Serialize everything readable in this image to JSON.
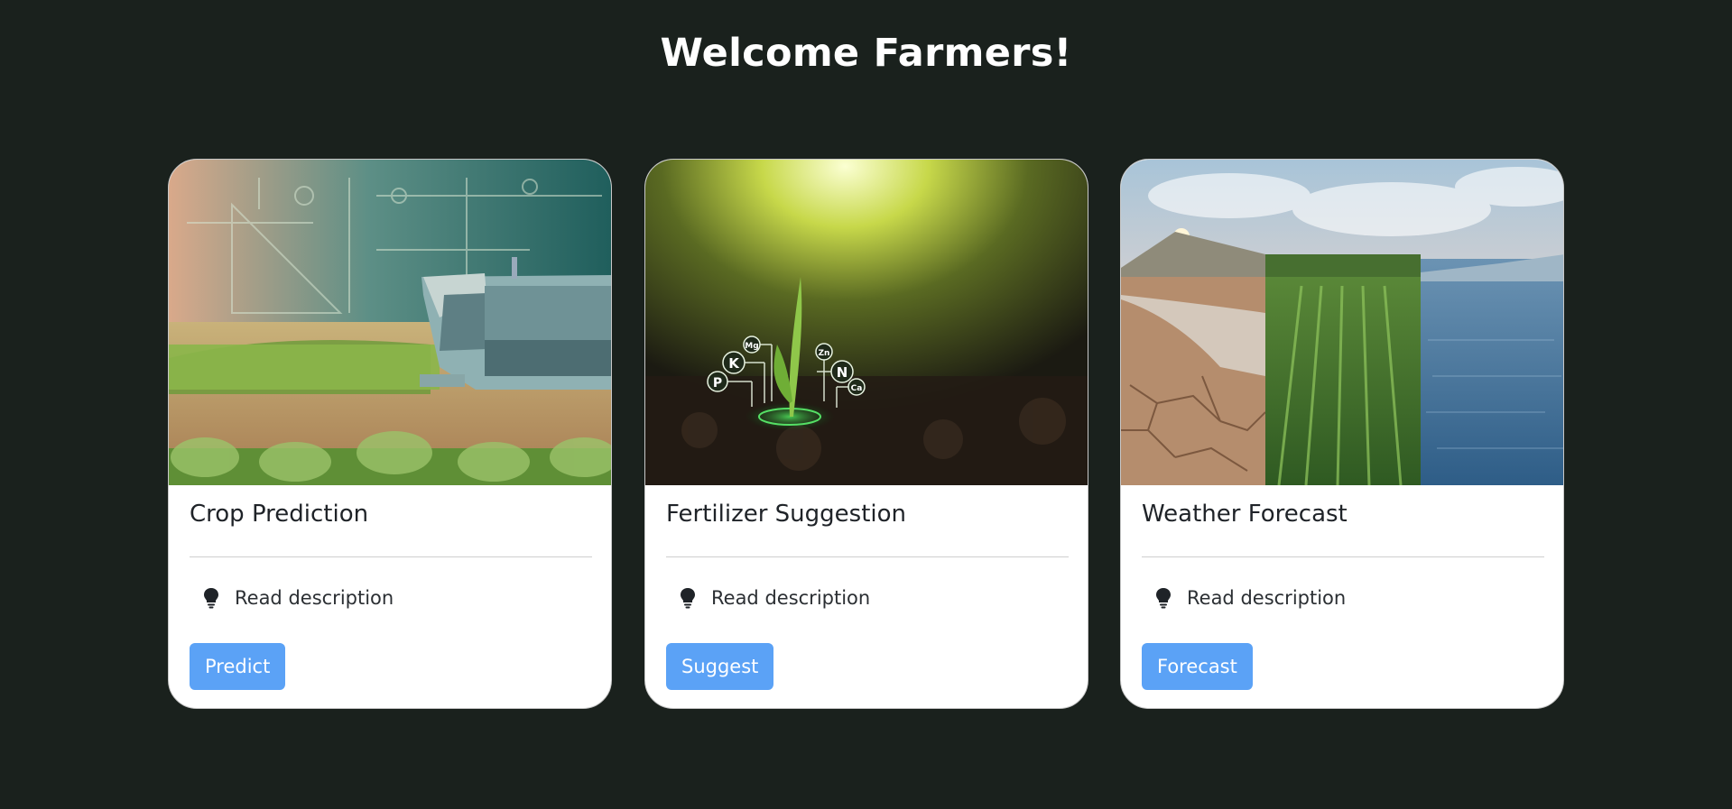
{
  "page": {
    "title": "Welcome Farmers!"
  },
  "cards": [
    {
      "title": "Crop Prediction",
      "description_link": "Read description",
      "button_label": "Predict",
      "image": "autonomous-harvester-in-corn-field"
    },
    {
      "title": "Fertilizer Suggestion",
      "description_link": "Read description",
      "button_label": "Suggest",
      "image": "seedling-with-nutrient-icons",
      "nutrient_labels": [
        "P",
        "K",
        "Mg",
        "Zn",
        "N",
        "Ca"
      ]
    },
    {
      "title": "Weather Forecast",
      "description_link": "Read description",
      "button_label": "Forecast",
      "image": "drought-field-flood-triptych"
    }
  ],
  "icons": {
    "description": "lightbulb-icon"
  },
  "colors": {
    "background": "#1a211d",
    "card": "#ffffff",
    "button": "#5ba2f6",
    "title_text": "#ffffff"
  }
}
